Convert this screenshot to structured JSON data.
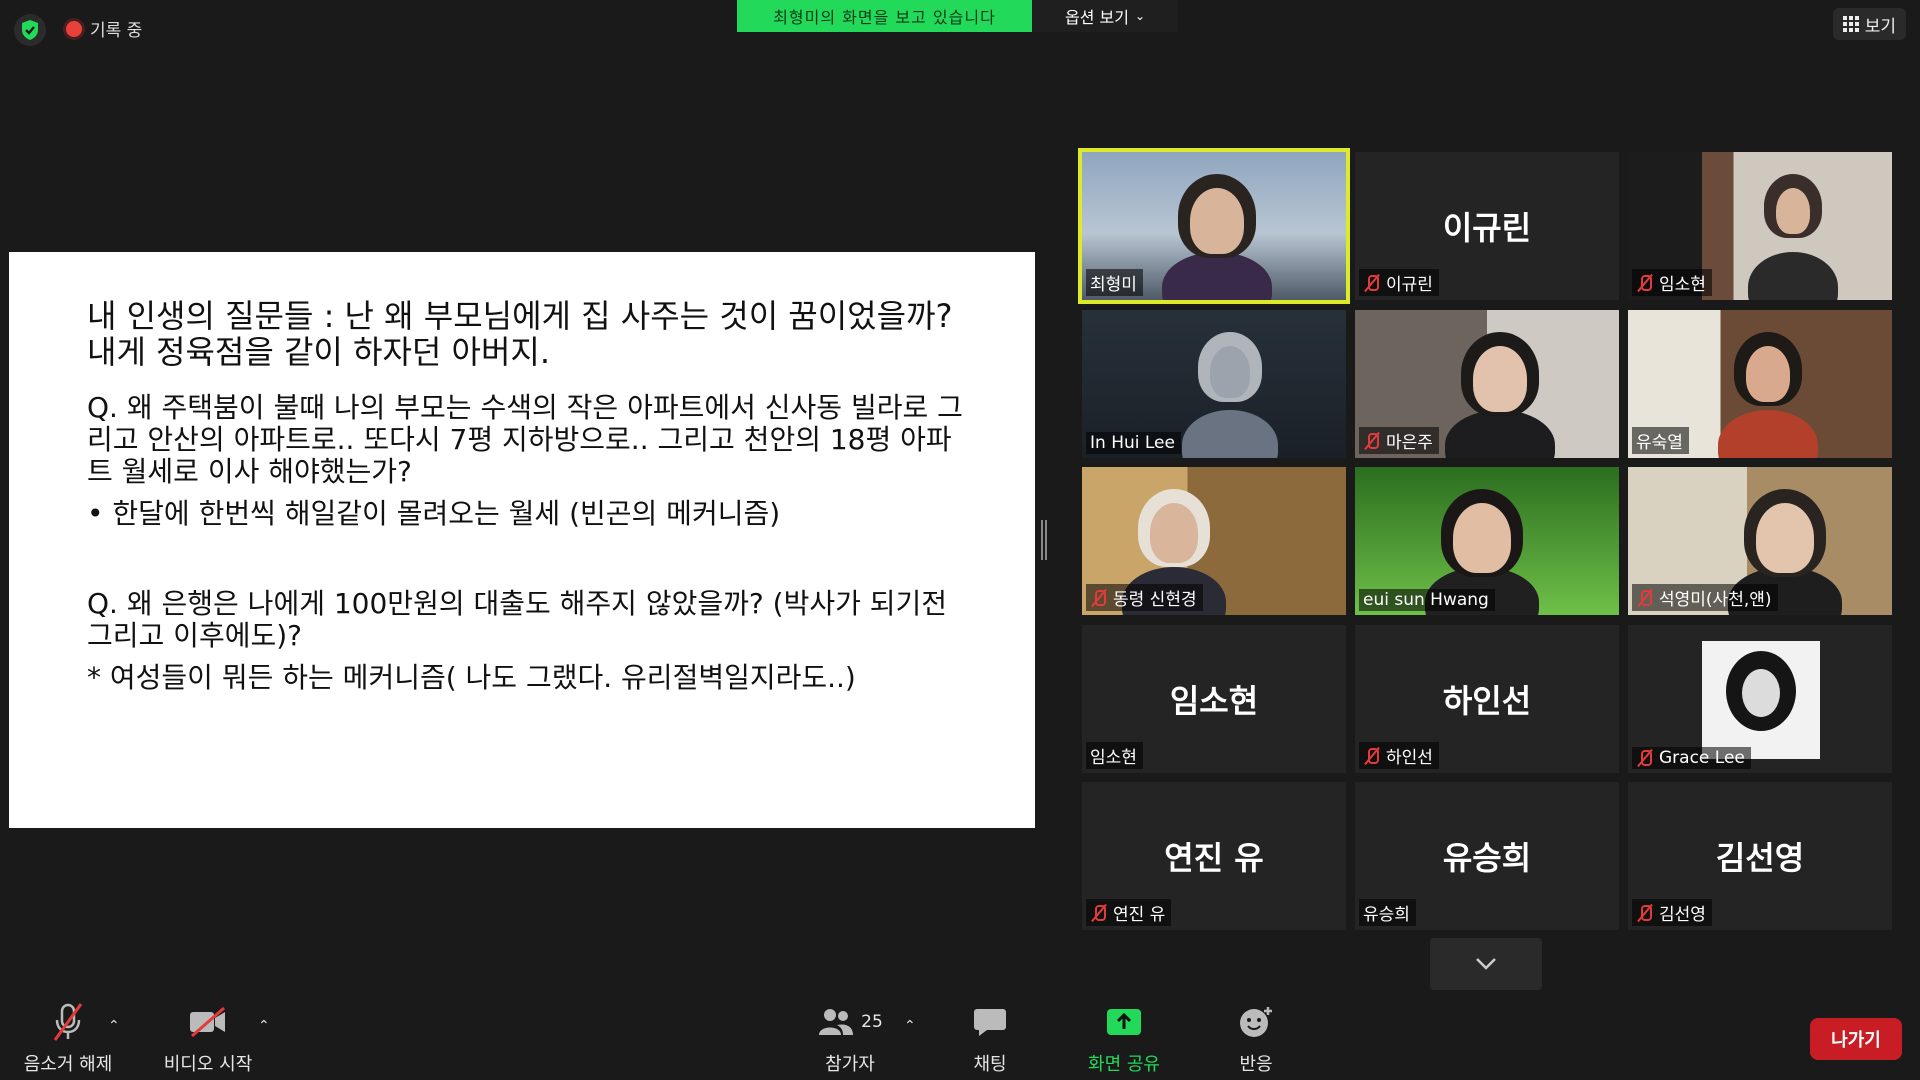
{
  "top": {
    "recording_label": "기록 중",
    "share_banner": "최형미의 화면을 보고 있습니다",
    "view_options": "옵션 보기",
    "view_button": "보기"
  },
  "slide": {
    "title": "내 인생의 질문들 : 난 왜 부모님에게 집 사주는 것이 꿈이었을까? 내게 정육점을 같이 하자던 아버지.",
    "q1": "Q. 왜 주택붐이 불때 나의 부모는 수색의 작은 아파트에서 신사동 빌라로 그리고 안산의 아파트로.. 또다시 7평 지하방으로.. 그리고 천안의 18평 아파트 월세로 이사 해야했는가?",
    "b1": "• 한달에 한번씩 해일같이 몰려오는 월세 (빈곤의 메커니즘)",
    "q2": "Q. 왜 은행은 나에게 100만원의 대출도 해주지 않았을까? (박사가 되기전 그리고 이후에도)?",
    "b2": "* 여성들이 뭐든 하는 메커니즘( 나도 그랬다. 유리절벽일지라도..)"
  },
  "participants": [
    {
      "name": "최형미",
      "muted": false,
      "video": true,
      "big": ""
    },
    {
      "name": "이규린",
      "muted": true,
      "video": false,
      "big": "이규린"
    },
    {
      "name": "임소현",
      "muted": true,
      "video": true,
      "big": ""
    },
    {
      "name": "In Hui Lee",
      "muted": false,
      "video": true,
      "big": ""
    },
    {
      "name": "마은주",
      "muted": true,
      "video": true,
      "big": ""
    },
    {
      "name": "유숙열",
      "muted": false,
      "video": true,
      "big": ""
    },
    {
      "name": "동령 신현경",
      "muted": true,
      "video": true,
      "big": ""
    },
    {
      "name": "eui sun Hwang",
      "muted": false,
      "video": true,
      "big": ""
    },
    {
      "name": "석영미(사천,얜)",
      "muted": true,
      "video": true,
      "big": ""
    },
    {
      "name": "임소현",
      "muted": false,
      "video": false,
      "big": "임소현"
    },
    {
      "name": "하인선",
      "muted": true,
      "video": false,
      "big": "하인선"
    },
    {
      "name": "Grace Lee",
      "muted": true,
      "video": true,
      "big": ""
    },
    {
      "name": "연진 유",
      "muted": true,
      "video": false,
      "big": "연진 유"
    },
    {
      "name": "유승희",
      "muted": false,
      "video": false,
      "big": "유승희"
    },
    {
      "name": "김선영",
      "muted": true,
      "video": false,
      "big": "김선영"
    }
  ],
  "toolbar": {
    "mute_label": "음소거 해제",
    "video_label": "비디오 시작",
    "participants_label": "참가자",
    "participants_count": "25",
    "chat_label": "채팅",
    "share_label": "화면 공유",
    "reactions_label": "반응",
    "leave_label": "나가기"
  },
  "colors": {
    "accent_green": "#23d959",
    "active_speaker": "#dcea2a",
    "leave_red": "#c81d25",
    "muted_red": "#e23b3b"
  }
}
